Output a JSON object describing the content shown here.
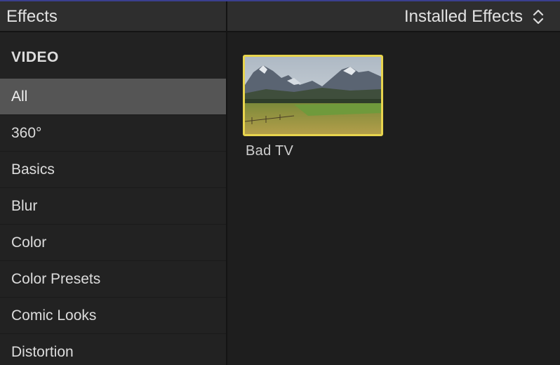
{
  "header": {
    "title": "Effects",
    "installed_label": "Installed Effects",
    "installed_icon": "chevron-up-down-icon"
  },
  "sidebar": {
    "section": "VIDEO",
    "items": [
      {
        "label": "All",
        "selected": true
      },
      {
        "label": "360°",
        "selected": false
      },
      {
        "label": "Basics",
        "selected": false
      },
      {
        "label": "Blur",
        "selected": false
      },
      {
        "label": "Color",
        "selected": false
      },
      {
        "label": "Color Presets",
        "selected": false
      },
      {
        "label": "Comic Looks",
        "selected": false
      },
      {
        "label": "Distortion",
        "selected": false
      }
    ]
  },
  "browser": {
    "effects": [
      {
        "name": "Bad TV",
        "selected": true
      }
    ]
  },
  "colors": {
    "selection_border": "#e8d44d",
    "selected_row": "#555555",
    "accent_line": "#3a3f8f"
  }
}
